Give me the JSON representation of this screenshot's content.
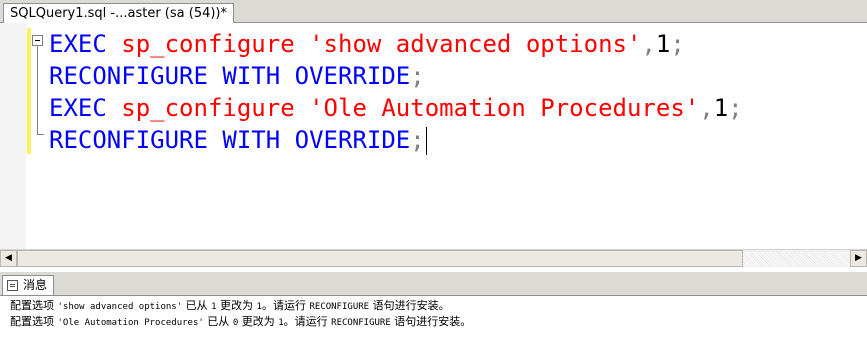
{
  "tab": {
    "title": "SQLQuery1.sql -...aster (sa (54))*"
  },
  "code_lines": [
    [
      {
        "t": "EXEC",
        "c": "kw"
      },
      {
        "t": " ",
        "c": "txt"
      },
      {
        "t": "sp_configure",
        "c": "str"
      },
      {
        "t": " ",
        "c": "txt"
      },
      {
        "t": "'show advanced options'",
        "c": "str"
      },
      {
        "t": ",",
        "c": "op"
      },
      {
        "t": "1",
        "c": "txt"
      },
      {
        "t": ";",
        "c": "op"
      }
    ],
    [
      {
        "t": "RECONFIGURE",
        "c": "kw"
      },
      {
        "t": " ",
        "c": "txt"
      },
      {
        "t": "WITH",
        "c": "kw"
      },
      {
        "t": " ",
        "c": "txt"
      },
      {
        "t": "OVERRIDE",
        "c": "kw"
      },
      {
        "t": ";",
        "c": "op"
      }
    ],
    [
      {
        "t": "EXEC",
        "c": "kw"
      },
      {
        "t": " ",
        "c": "txt"
      },
      {
        "t": "sp_configure",
        "c": "str"
      },
      {
        "t": " ",
        "c": "txt"
      },
      {
        "t": "'Ole Automation Procedures'",
        "c": "str"
      },
      {
        "t": ",",
        "c": "op"
      },
      {
        "t": "1",
        "c": "txt"
      },
      {
        "t": ";",
        "c": "op"
      }
    ],
    [
      {
        "t": "RECONFIGURE",
        "c": "kw"
      },
      {
        "t": " ",
        "c": "txt"
      },
      {
        "t": "WITH",
        "c": "kw"
      },
      {
        "t": " ",
        "c": "txt"
      },
      {
        "t": "OVERRIDE",
        "c": "kw"
      },
      {
        "t": ";",
        "c": "op"
      }
    ]
  ],
  "results": {
    "tab_label": "消息",
    "icon": "messages-icon",
    "messages": [
      [
        {
          "t": "配置选项 ",
          "m": false
        },
        {
          "t": "'show advanced options'",
          "m": true
        },
        {
          "t": " 已从 ",
          "m": false
        },
        {
          "t": "1",
          "m": true
        },
        {
          "t": " 更改为 ",
          "m": false
        },
        {
          "t": "1",
          "m": true
        },
        {
          "t": "。请运行 ",
          "m": false
        },
        {
          "t": "RECONFIGURE",
          "m": true
        },
        {
          "t": " 语句进行安装。",
          "m": false
        }
      ],
      [
        {
          "t": "配置选项 ",
          "m": false
        },
        {
          "t": "'Ole Automation Procedures'",
          "m": true
        },
        {
          "t": " 已从 ",
          "m": false
        },
        {
          "t": "0",
          "m": true
        },
        {
          "t": " 更改为 ",
          "m": false
        },
        {
          "t": "1",
          "m": true
        },
        {
          "t": "。请运行 ",
          "m": false
        },
        {
          "t": "RECONFIGURE",
          "m": true
        },
        {
          "t": " 语句进行安装。",
          "m": false
        }
      ]
    ]
  },
  "colors": {
    "keyword": "#0000ff",
    "string": "#ff0000",
    "operator": "#808080",
    "change_bar": "#ffee62"
  }
}
